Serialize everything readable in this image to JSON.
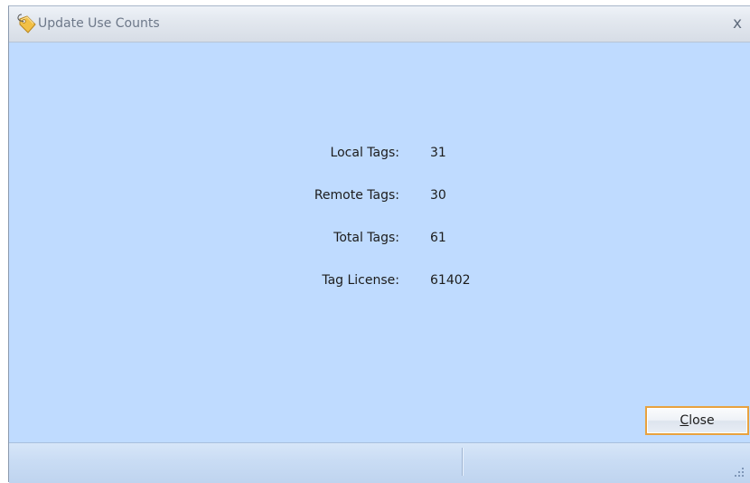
{
  "window": {
    "title": "Update Use Counts",
    "close_glyph": "x",
    "title_icon": "tag-icon"
  },
  "fields": [
    {
      "label": "Local Tags:",
      "value": "31"
    },
    {
      "label": "Remote Tags:",
      "value": "30"
    },
    {
      "label": "Total Tags:",
      "value": "61"
    },
    {
      "label": "Tag License:",
      "value": "61402"
    }
  ],
  "buttons": {
    "close_mnemonic": "C",
    "close_rest": "lose"
  },
  "colors": {
    "background": "#bfdbff",
    "button_border": "#e8a23f",
    "titlebar": "#e3e8ef"
  }
}
